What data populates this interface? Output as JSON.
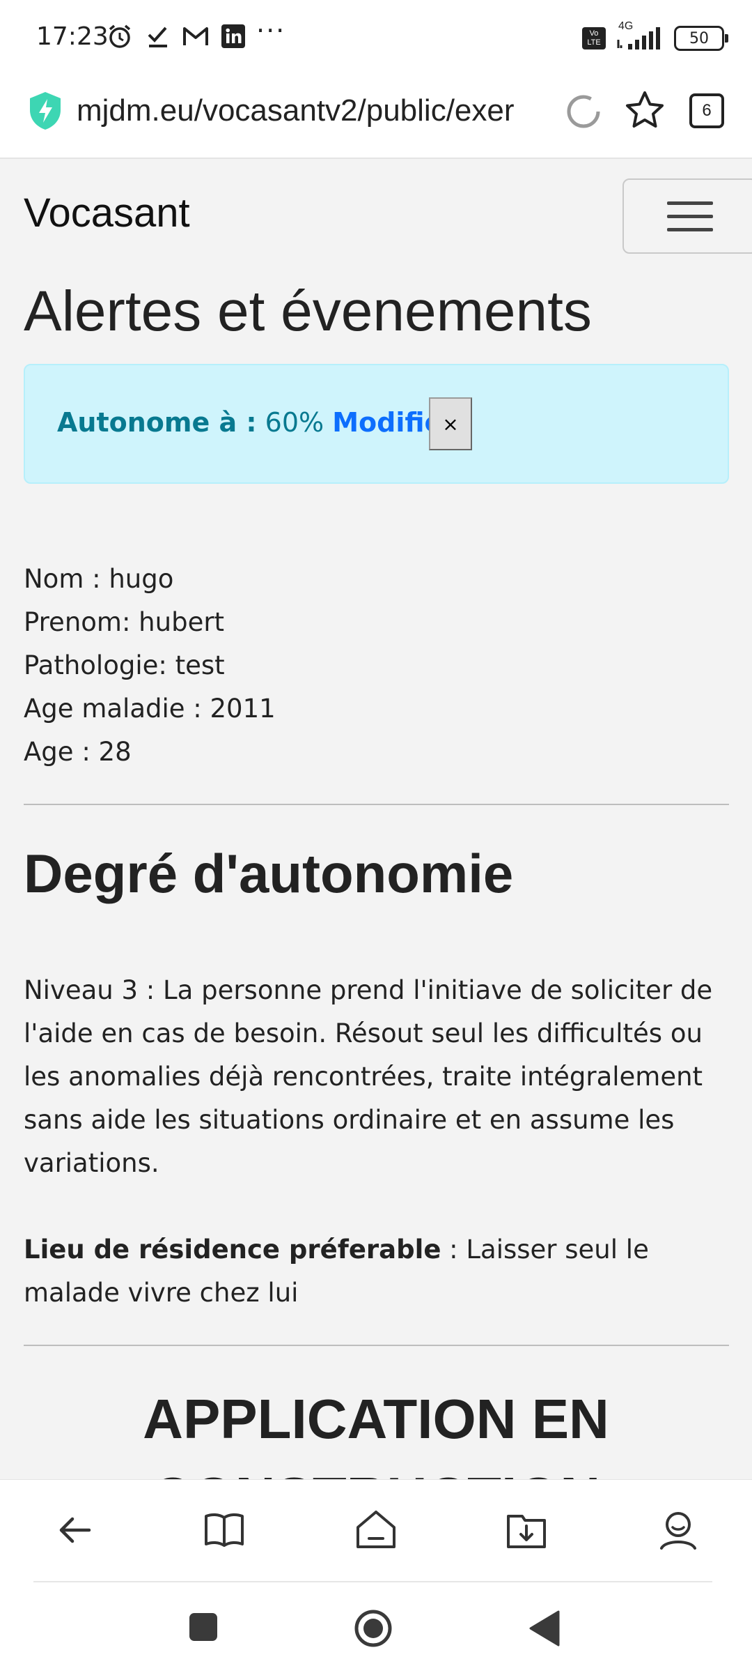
{
  "status_bar": {
    "time": "17:23",
    "more": "···",
    "network": "4G",
    "volte": "Vo LTE",
    "battery": "50"
  },
  "browser": {
    "url": "mjdm.eu/vocasantv2/public/exer",
    "tab_count": "6",
    "accent_color": "#3dd6b3"
  },
  "navbar": {
    "brand": "Vocasant"
  },
  "page": {
    "title": "Alertes et évenements",
    "alert": {
      "label": "Autonome à :",
      "value": "60%",
      "link": "Modifier",
      "close": "×"
    },
    "patient": {
      "nom": "Nom : hugo",
      "prenom": "Prenom: hubert",
      "pathologie": "Pathologie: test",
      "age_maladie": "Age maladie : 2011",
      "age": "Age : 28"
    },
    "autonomy": {
      "title": "Degré d'autonomie",
      "level_text": "Niveau 3 : La personne prend l'initiave de soliciter de l'aide en cas de besoin. Résout seul les difficultés ou les anomalies déjà rencontrées, traite intégralement sans aide les situations ordinaire et en assume les variations.",
      "residence_label": "Lieu de résidence préferable",
      "residence_value": " : Laisser seul le malade vivre chez lui"
    },
    "construction": "APPLICATION EN CONSTRUCTION"
  },
  "bottom_bar": {
    "items": [
      "back-icon",
      "book-icon",
      "home-icon",
      "download-folder-icon",
      "profile-icon"
    ]
  },
  "system_nav": {
    "items": [
      "recents-icon",
      "home-icon",
      "back-icon"
    ]
  }
}
